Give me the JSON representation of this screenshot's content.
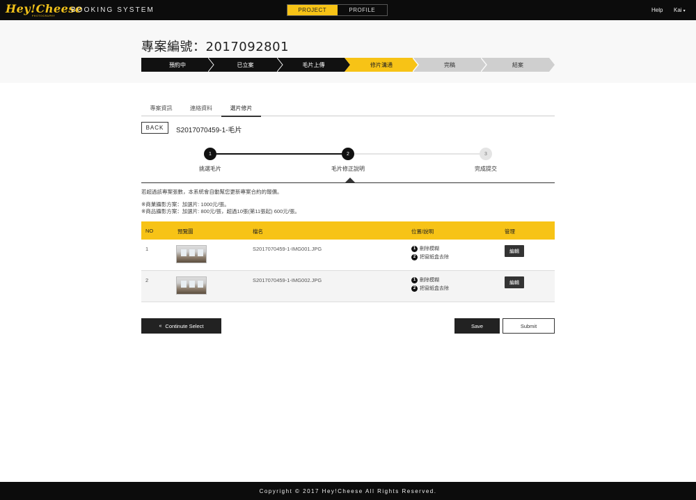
{
  "header": {
    "logo_text": "Hey!Cheese",
    "logo_sub": "PHOTOGRAPHY",
    "app_name": "BOOKING SYSTEM",
    "tabs": [
      {
        "label": "PROJECT",
        "active": true
      },
      {
        "label": "PROFILE",
        "active": false
      }
    ],
    "help_label": "Help",
    "user_label": "Kai",
    "accent_color": "#f7c316"
  },
  "page": {
    "title": "專案編號：2017092801"
  },
  "progress": {
    "steps": [
      {
        "label": "預約中",
        "state": "done"
      },
      {
        "label": "已立案",
        "state": "done"
      },
      {
        "label": "毛片上傳",
        "state": "done"
      },
      {
        "label": "修片溝通",
        "state": "current"
      },
      {
        "label": "完稿",
        "state": "todo"
      },
      {
        "label": "結案",
        "state": "todo"
      }
    ]
  },
  "subtabs": [
    {
      "label": "專案資訊",
      "active": false
    },
    {
      "label": "連絡資料",
      "active": false
    },
    {
      "label": "選片修片",
      "active": true
    }
  ],
  "back_label": "BACK",
  "folder_title": "S2017070459-1-毛片",
  "stepper": [
    {
      "num": "1",
      "label": "挑選毛片",
      "state": "done"
    },
    {
      "num": "2",
      "label": "毛片修正說明",
      "state": "current"
    },
    {
      "num": "3",
      "label": "完成提交",
      "state": "todo"
    }
  ],
  "notes": {
    "line1": "若超過該專案張數，本系統會自動幫您更新專案合約的報價。",
    "line2": "※商業攝影方案：加選片: 1000元/張。",
    "line3": "※商品攝影方案：加選片: 800元/張，超過10張(第11張起) 600元/張。"
  },
  "table": {
    "headers": {
      "no": "NO",
      "preview": "預覽圖",
      "filename": "檔名",
      "position": "位置/說明",
      "manage": "管理"
    },
    "rows": [
      {
        "no": "1",
        "filename": "S2017070459-1-IMG001.JPG",
        "notes": [
          {
            "num": "1",
            "text": "刪除模糊"
          },
          {
            "num": "2",
            "text": "把窗紙盒去除"
          }
        ],
        "edit_label": "編輯"
      },
      {
        "no": "2",
        "filename": "S2017070459-1-IMG002.JPG",
        "notes": [
          {
            "num": "1",
            "text": "刪除模糊"
          },
          {
            "num": "2",
            "text": "把窗紙盒去除"
          }
        ],
        "edit_label": "編輯"
      }
    ]
  },
  "actions": {
    "continue_label": "Continute Select",
    "save_label": "Save",
    "submit_label": "Submit"
  },
  "footer": {
    "copyright": "Copyright © 2017 Hey!Cheese All Rights Reserved."
  }
}
